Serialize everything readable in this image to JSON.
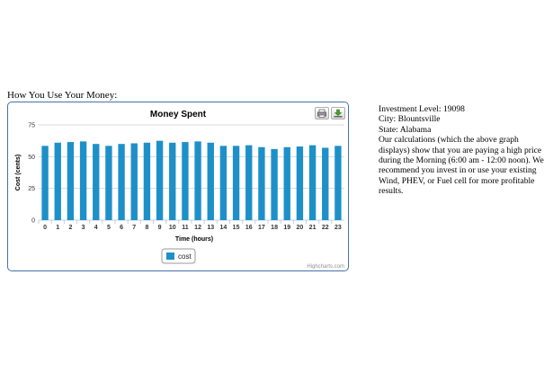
{
  "section": {
    "label": "How You Use Your Money:"
  },
  "chart_data": {
    "type": "bar",
    "title": "Money Spent",
    "xlabel": "Time (hours)",
    "ylabel": "Cost (cents)",
    "ylim": [
      0,
      75
    ],
    "yticks": [
      0,
      25,
      50,
      75
    ],
    "categories": [
      "0",
      "1",
      "2",
      "3",
      "4",
      "5",
      "6",
      "7",
      "8",
      "9",
      "10",
      "11",
      "12",
      "13",
      "14",
      "15",
      "16",
      "17",
      "18",
      "19",
      "20",
      "21",
      "22",
      "23"
    ],
    "series": [
      {
        "name": "cost",
        "color": "#1e90c8",
        "values": [
          58.5,
          61,
          61.5,
          62,
          60,
          58.5,
          60,
          60.5,
          61,
          62.5,
          61,
          61.5,
          62,
          61,
          58.5,
          58.5,
          59,
          57.5,
          56,
          57.5,
          58,
          59,
          57,
          58.5
        ]
      }
    ],
    "grid": true,
    "legend": "bottom-center",
    "credits": "Highcharts.com"
  },
  "icons": {
    "print": "print-icon",
    "export": "download-icon"
  },
  "info": {
    "investment": "Investment Level: 19098",
    "city": "City: Blountsville",
    "state": "State: Alabama",
    "message": "Our calculations (which the above graph displays) show that you are paying a high price during the Morning (6:00 am - 12:00 noon). We recommend you invest in or use your existing Wind, PHEV, or Fuel cell for more profitable results."
  }
}
